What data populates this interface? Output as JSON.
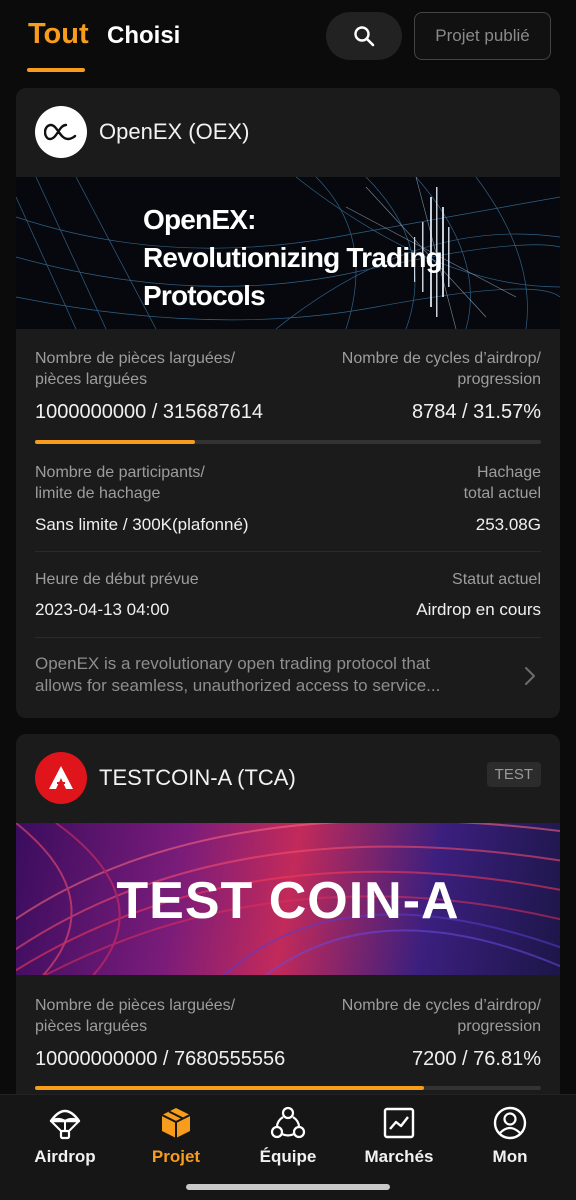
{
  "tabs": {
    "all": "Tout",
    "chosen": "Choisi"
  },
  "header": {
    "publish_label": "Projet publié"
  },
  "colors": {
    "accent": "#f79c1b",
    "background": "#0b0b0b",
    "card": "#1b1b1b"
  },
  "projects": [
    {
      "name": "OpenEX (OEX)",
      "banner_text": [
        "OpenEX:",
        "Revolutionizing Trading",
        "Protocols"
      ],
      "labels": {
        "coins": [
          "Nombre de pièces larguées/",
          "pièces larguées"
        ],
        "cycles": [
          "Nombre de cycles d’airdrop/",
          "progression"
        ],
        "participants": [
          "Nombre de participants/",
          "limite de hachage"
        ],
        "hash": [
          "Hachage",
          "total actuel"
        ],
        "start": "Heure de début prévue",
        "status": "Statut actuel"
      },
      "coins_value": "1000000000 / 315687614",
      "cycles_value": "8784 / 31.57%",
      "progress": 0.3157,
      "participants_value": "Sans limite / 300K(plafonné)",
      "hash_value": "253.08G",
      "start_value": "2023-04-13 04:00",
      "status_value": "Airdrop en cours",
      "description": [
        "OpenEX is a revolutionary open trading protocol that",
        "allows for seamless, unauthorized access to service..."
      ]
    },
    {
      "name": "TESTCOIN-A (TCA)",
      "badge": "TEST",
      "banner_text": [
        "TEST",
        "COIN-A"
      ],
      "labels": {
        "coins": [
          "Nombre de pièces larguées/",
          "pièces larguées"
        ],
        "cycles": [
          "Nombre de cycles d’airdrop/",
          "progression"
        ]
      },
      "coins_value": "10000000000 / 7680555556",
      "cycles_value": "7200 / 76.81%",
      "progress": 0.7681
    }
  ],
  "nav": [
    {
      "label": "Airdrop",
      "icon": "parachute-icon"
    },
    {
      "label": "Projet",
      "icon": "box-icon",
      "active": true
    },
    {
      "label": "Équipe",
      "icon": "team-icon"
    },
    {
      "label": "Marchés",
      "icon": "chart-icon"
    },
    {
      "label": "Mon",
      "icon": "user-icon"
    }
  ]
}
